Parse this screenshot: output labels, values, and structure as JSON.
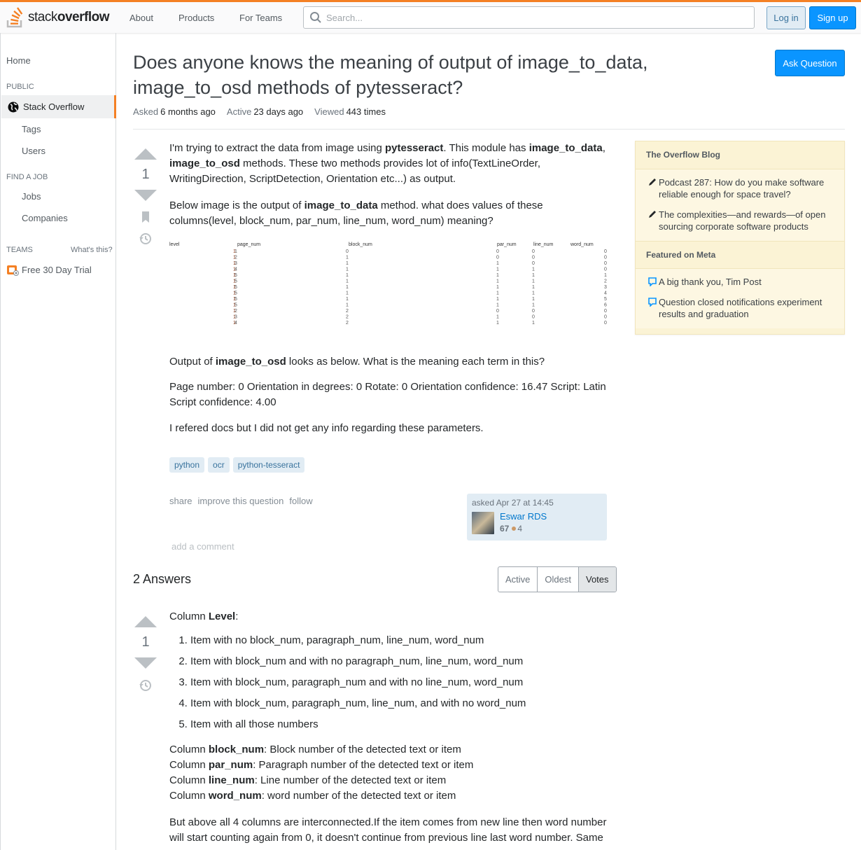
{
  "header": {
    "logo_text_light": "stack",
    "logo_text_bold": "overflow",
    "nav": [
      "About",
      "Products",
      "For Teams"
    ],
    "search_placeholder": "Search...",
    "login": "Log in",
    "signup": "Sign up"
  },
  "sidebar": {
    "home": "Home",
    "public_header": "PUBLIC",
    "stack_overflow": "Stack Overflow",
    "tags": "Tags",
    "users": "Users",
    "find_job_header": "FIND A JOB",
    "jobs": "Jobs",
    "companies": "Companies",
    "teams_header": "TEAMS",
    "whats_this": "What's this?",
    "free_trial": "Free 30 Day Trial"
  },
  "question": {
    "title_line1": "Does anyone knows the meaning of output of image_to_data,",
    "title_line2": "image_to_osd methods of pytesseract?",
    "ask_button": "Ask Question",
    "meta": {
      "asked_label": "Asked",
      "asked_value": "6 months ago",
      "active_label": "Active",
      "active_value": "23 days ago",
      "viewed_label": "Viewed",
      "viewed_value": "443 times"
    },
    "votes": "1",
    "p1": {
      "a": "I'm trying to extract the data from image using ",
      "b1": "pytesseract",
      "c": ". This module has ",
      "b2": "image_to_data",
      "d": ",",
      "b3": "image_to_osd",
      "e": " methods. These two methods provides lot of info(TextLineOrder, WritingDirection, ScriptDetection, Orientation etc...) as output."
    },
    "p2": {
      "a": "Below image is the output of ",
      "b": "image_to_data",
      "c": " method. what does values of these columns(level, block_num, par_num, line_num, word_num) meaning?"
    },
    "figure": {
      "headers": [
        "level",
        "page_num",
        "block_num",
        "par_num",
        "line_num",
        "word_num"
      ],
      "level": [
        "1",
        "2",
        "3",
        "4",
        "5",
        "5",
        "5",
        "5",
        "5",
        "5",
        "2",
        "3",
        "4"
      ],
      "page_num": [
        "1",
        "1",
        "1",
        "1",
        "1",
        "1",
        "1",
        "1",
        "1",
        "1",
        "1",
        "1",
        "1"
      ],
      "block_num": [
        "0",
        "1",
        "1",
        "1",
        "1",
        "1",
        "1",
        "1",
        "1",
        "1",
        "2",
        "2",
        "2"
      ],
      "par_num": [
        "0",
        "0",
        "1",
        "1",
        "1",
        "1",
        "1",
        "1",
        "1",
        "1",
        "0",
        "1",
        "1"
      ],
      "line_num": [
        "0",
        "0",
        "0",
        "1",
        "1",
        "1",
        "1",
        "1",
        "1",
        "1",
        "0",
        "0",
        "1"
      ],
      "word_num": [
        "0",
        "0",
        "0",
        "0",
        "1",
        "2",
        "3",
        "4",
        "5",
        "6",
        "0",
        "0",
        "0"
      ]
    },
    "p3": {
      "a": "Output of ",
      "b": "image_to_osd",
      "c": " looks as below. What is the meaning each term in this?"
    },
    "p4": "Page number: 0 Orientation in degrees: 0 Rotate: 0 Orientation confidence: 16.47 Script: Latin Script confidence: 4.00",
    "p5": "I refered docs but I did not get any info regarding these parameters.",
    "tags": [
      "python",
      "ocr",
      "python-tesseract"
    ],
    "menu": [
      "share",
      "improve this question",
      "follow"
    ],
    "owner": {
      "asked": "asked Apr 27 at 14:45",
      "name": "Eswar RDS",
      "rep": "67",
      "bronze": "4"
    },
    "add_comment": "add a comment"
  },
  "answers": {
    "count_label": "2 Answers",
    "sort_tabs": [
      "Active",
      "Oldest",
      "Votes"
    ],
    "sort_selected": "Votes",
    "first": {
      "votes": "1",
      "intro_a": "Column ",
      "intro_b": "Level",
      "intro_c": ":",
      "items": [
        "Item with no block_num, paragraph_num, line_num, word_num",
        "Item with block_num and with no paragraph_num, line_num, word_num",
        "Item with block_num, paragraph_num and with no line_num, word_num",
        "Item with block_num, paragraph_num, line_num, and with no word_num",
        "Item with all those numbers"
      ],
      "cols": [
        {
          "a": "Column ",
          "b": "block_num",
          "c": ": Block number of the detected text or item"
        },
        {
          "a": "Column ",
          "b": "par_num",
          "c": ": Paragraph number of the detected text or item"
        },
        {
          "a": "Column ",
          "b": "line_num",
          "c": ": Line number of the detected text or item"
        },
        {
          "a": "Column ",
          "b": "word_num",
          "c": ": word number of the detected text or item"
        }
      ],
      "tail": "But above all 4 columns are interconnected.If the item comes from new line then word number will start counting again from 0, it doesn't continue from previous line last word number. Same"
    }
  },
  "right": {
    "blog_header": "The Overflow Blog",
    "blog_items": [
      "Podcast 287: How do you make software reliable enough for space travel?",
      "The complexities—and rewards—of open sourcing corporate software products"
    ],
    "meta_header": "Featured on Meta",
    "meta_items": [
      "A big thank you, Tim Post",
      "Question closed notifications experiment results and graduation"
    ]
  },
  "colors": {
    "accent": "#f48024",
    "primary": "#0a95ff",
    "tag_bg": "#e1ecf4",
    "tag_text": "#39739d",
    "blog_bg": "#fbf3d5"
  }
}
